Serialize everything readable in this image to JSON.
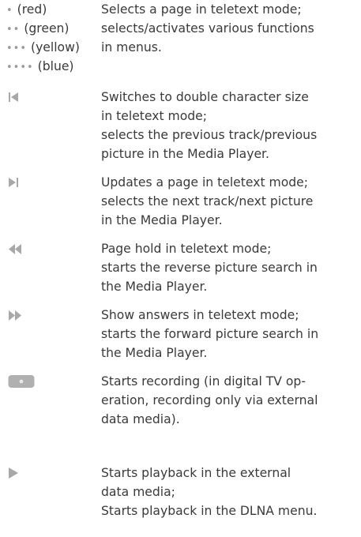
{
  "color_buttons": {
    "items": [
      {
        "dots": "•",
        "label": "(red)"
      },
      {
        "dots": "••",
        "label": "(green)"
      },
      {
        "dots": "•••",
        "label": "(yellow)"
      },
      {
        "dots": "••••",
        "label": "(blue)"
      }
    ],
    "description": [
      "Selects a page in teletext mode;",
      "selects/activates various functions",
      "in menus."
    ]
  },
  "entries": [
    {
      "icon": "skip-previous-icon",
      "lines": [
        "Switches to double character size",
        "in teletext mode;",
        "selects the previous track/previous",
        "picture in the Media Player."
      ]
    },
    {
      "icon": "skip-next-icon",
      "lines": [
        "Updates a page in teletext mode;",
        "selects the next track/next picture",
        "in the Media Player."
      ]
    },
    {
      "icon": "rewind-icon",
      "lines": [
        "Page hold in teletext mode;",
        "starts the reverse picture search in",
        "the Media Player."
      ]
    },
    {
      "icon": "fast-forward-icon",
      "lines": [
        "Show answers in teletext mode;",
        "starts the forward picture search in",
        "the Media Player."
      ]
    },
    {
      "icon": "record-icon",
      "lines": [
        "Starts recording (in digital TV op-",
        "eration, recording only via external",
        "data media)."
      ]
    },
    {
      "icon": "play-icon",
      "lines": [
        "Starts playback in the external",
        "data media;",
        "Starts playback in the DLNA menu."
      ]
    }
  ],
  "colors": {
    "text": "#3a3a3a",
    "icon": "#a8a8a8",
    "red_dot": "#9a9a9a"
  }
}
